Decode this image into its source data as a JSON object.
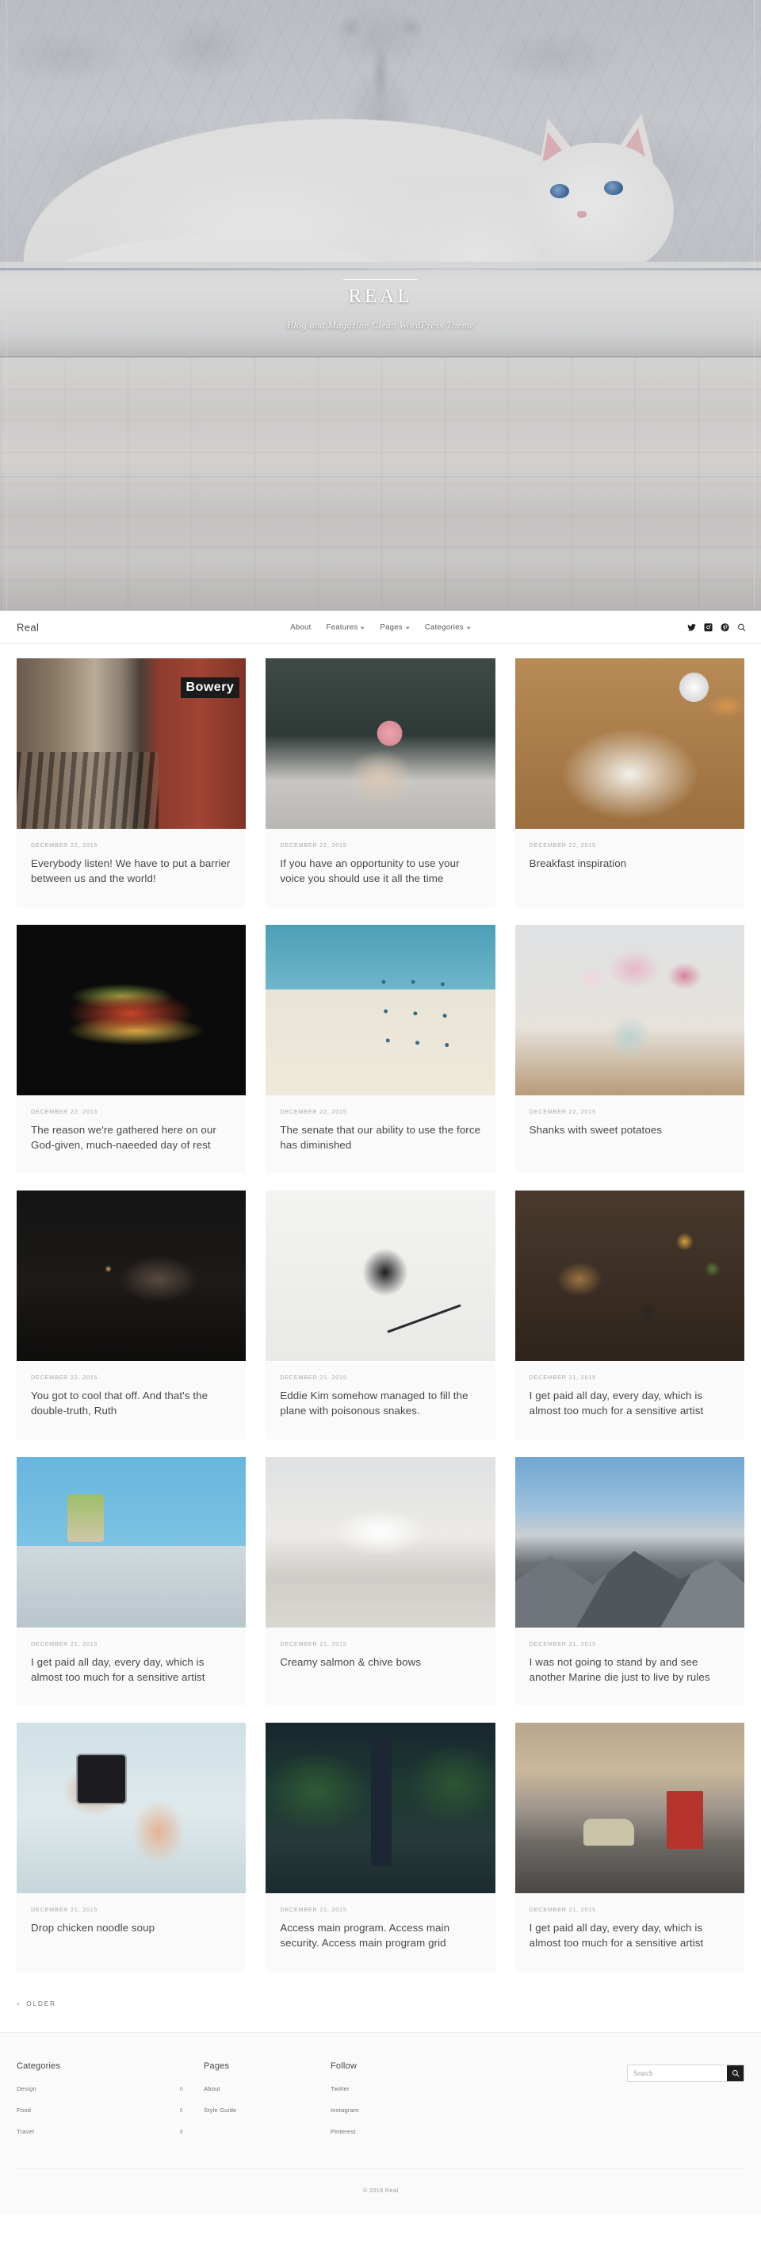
{
  "hero": {
    "title": "REAL",
    "subtitle": "Blog and Magazine Clean WordPress Theme"
  },
  "nav": {
    "logo": "Real",
    "items": [
      {
        "label": "About",
        "has_caret": false
      },
      {
        "label": "Features",
        "has_caret": true
      },
      {
        "label": "Pages",
        "has_caret": true
      },
      {
        "label": "Categories",
        "has_caret": true
      }
    ],
    "social": [
      "twitter-icon",
      "instagram-icon",
      "pinterest-icon",
      "search-icon"
    ]
  },
  "posts": [
    {
      "date": "DECEMBER 22, 2015",
      "title": "Everybody listen! We have to put a barrier between us and the world!",
      "photo": "subway-platform-bowery"
    },
    {
      "date": "DECEMBER 22, 2015",
      "title": "If you have an opportunity to use your voice you should use it all the time",
      "photo": "hands-holding-rose"
    },
    {
      "date": "DECEMBER 22, 2015",
      "title": "Breakfast inspiration",
      "photo": "journal-coffee-croissant"
    },
    {
      "date": "DECEMBER 22, 2015",
      "title": "The reason we're gathered here on our God-given, much-naeeded day of rest",
      "photo": "food-on-black"
    },
    {
      "date": "DECEMBER 22, 2015",
      "title": "The senate that our ability to use the force has diminished",
      "photo": "modern-building-blue-sky"
    },
    {
      "date": "DECEMBER 22, 2015",
      "title": "Shanks with sweet potatoes",
      "photo": "flower-vase"
    },
    {
      "date": "DECEMBER 22, 2015",
      "title": "You got to cool that off. And that's the double-truth, Ruth",
      "photo": "dark-hand-cigarette"
    },
    {
      "date": "DECEMBER 21, 2015",
      "title": "Eddie Kim somehow managed to fill the plane with poisonous snakes.",
      "photo": "coffee-mug-pen-desk"
    },
    {
      "date": "DECEMBER 21, 2015",
      "title": "I get paid all day, every day, which is almost too much for a sensitive artist",
      "photo": "spices-mortar-wood"
    },
    {
      "date": "DECEMBER 21, 2015",
      "title": "I get paid all day, every day, which is almost too much for a sensitive artist",
      "photo": "blue-wall-table"
    },
    {
      "date": "DECEMBER 21, 2015",
      "title": "Creamy salmon & chive bows",
      "photo": "white-cat-on-bench"
    },
    {
      "date": "DECEMBER 21, 2015",
      "title": "I was not going to stand by and see another Marine die just to live by rules",
      "photo": "mountain-clouds"
    },
    {
      "date": "DECEMBER 21, 2015",
      "title": "Drop chicken noodle soup",
      "photo": "smartwatch-on-wrist"
    },
    {
      "date": "DECEMBER 21, 2015",
      "title": "Access main program. Access main security. Access main program grid",
      "photo": "hiker-in-forest"
    },
    {
      "date": "DECEMBER 21, 2015",
      "title": "I get paid all day, every day, which is almost too much for a sensitive artist",
      "photo": "city-street-bus"
    }
  ],
  "pagination": {
    "older_label": "OLDER",
    "chevron": "‹"
  },
  "footer": {
    "categories": {
      "heading": "Categories",
      "items": [
        {
          "label": "Design",
          "count": "6"
        },
        {
          "label": "Food",
          "count": "6"
        },
        {
          "label": "Travel",
          "count": "9"
        }
      ]
    },
    "pages": {
      "heading": "Pages",
      "items": [
        "About",
        "Style Guide"
      ]
    },
    "follow": {
      "heading": "Follow",
      "items": [
        "Twitter",
        "Instagram",
        "Pinterest"
      ]
    },
    "search": {
      "placeholder": "Search",
      "value": ""
    },
    "copyright": "© 2016 Real"
  },
  "colors": {
    "card_bg": "#fafafa",
    "text_dark": "#44474c",
    "text_muted": "#a8a9ad",
    "search_button": "#1d1d1d"
  }
}
